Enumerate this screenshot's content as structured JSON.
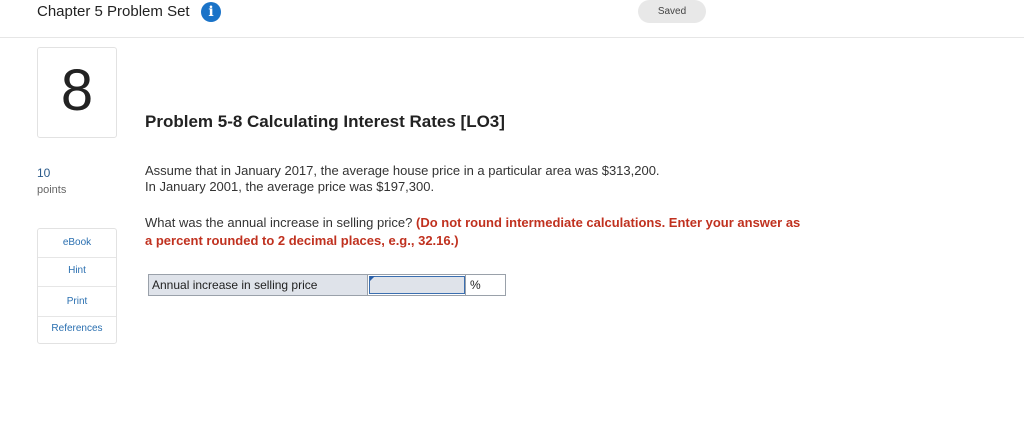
{
  "header": {
    "set_title": "Chapter 5 Problem Set",
    "info_icon": "info-icon",
    "saved_label": "Saved"
  },
  "question": {
    "number": "8",
    "points_value": "10",
    "points_label": "points",
    "title": "Problem 5-8 Calculating Interest Rates [LO3]",
    "paragraph1_line1": "Assume that in January 2017, the average house price in a particular area was $313,200.",
    "paragraph1_line2": "In January 2001, the average price was $197,300.",
    "paragraph2_text": "What was the annual increase in selling price? ",
    "paragraph2_instruction": "(Do not round intermediate calculations. Enter your answer as a percent rounded to 2 decimal places, e.g., 32.16.)"
  },
  "side_menu": {
    "items": [
      {
        "label": "eBook"
      },
      {
        "label": "Hint"
      },
      {
        "label": "Print"
      },
      {
        "label": "References"
      }
    ]
  },
  "answer": {
    "label": "Annual increase in selling price",
    "value": "",
    "unit": "%"
  }
}
